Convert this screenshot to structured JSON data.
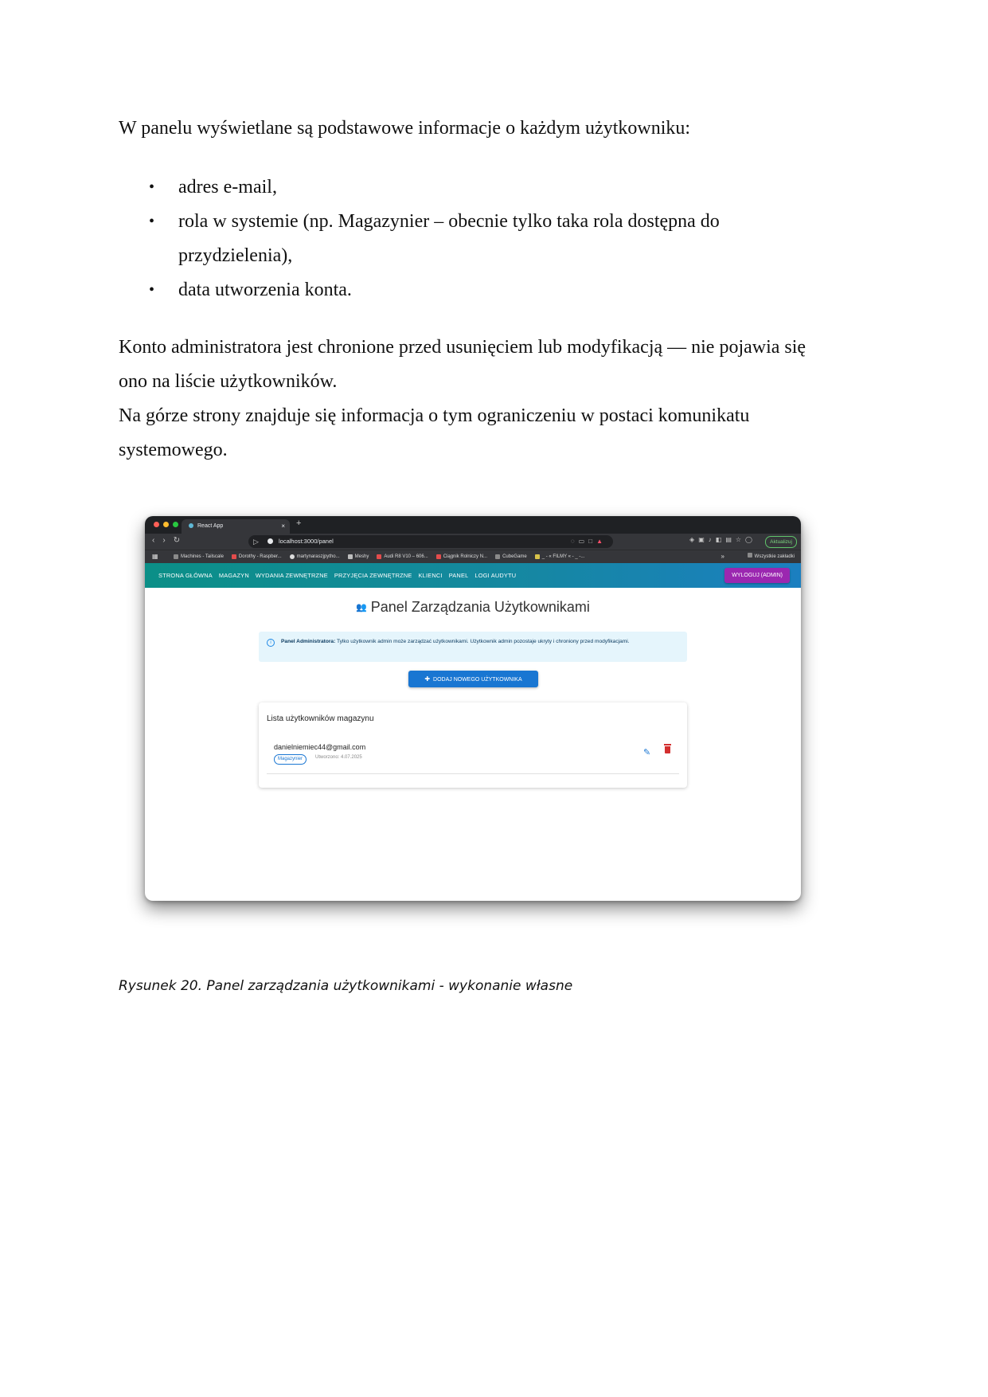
{
  "document": {
    "intro": "W panelu wyświetlane są podstawowe informacje o każdym użytkowniku:",
    "bullets": [
      "adres e-mail,",
      "rola w systemie (np. Magazynier – obecnie tylko taka rola dostępna do przydzielenia),",
      "data utworzenia konta."
    ],
    "paragraph_1": "Konto administratora jest chronione przed usunięciem lub modyfikacją — nie pojawia się ono na liście użytkowników.",
    "paragraph_2": "Na górze strony znajduje się informacja o tym ograniczeniu w postaci komunikatu systemowego.",
    "caption": "Rysunek 20. Panel zarządzania użytkownikami - wykonanie własne"
  },
  "browser": {
    "tab_title": "React App",
    "tab_close": "×",
    "new_tab": "+",
    "url": "localhost:3000/panel",
    "update_button": "Aktualizuj",
    "bookmarks": [
      {
        "label": "Machines - Tailscale",
        "color": "#8a8a8a"
      },
      {
        "label": "Dorothy - Raspber...",
        "color": "#e34c4c"
      },
      {
        "label": "martynaraszjpytho...",
        "color": "#dcdcdc"
      },
      {
        "label": "Meshy",
        "color": "#bdbdbd"
      },
      {
        "label": "Audi R8 V10 – 606...",
        "color": "#e34c4c"
      },
      {
        "label": "Ciągnik Rolniczy N...",
        "color": "#e34c4c"
      },
      {
        "label": "CubeGame",
        "color": "#8a8a8a"
      },
      {
        "label": "_ - « FILMY « - _ -...",
        "color": "#d8c34a"
      }
    ],
    "bookmarks_more": "»",
    "all_bookmarks": "Wszystkie zakładki"
  },
  "app": {
    "nav": [
      "STRONA GŁÓWNA",
      "MAGAZYN",
      "WYDANIA ZEWNĘTRZNE",
      "PRZYJĘCIA ZEWNĘTRZNE",
      "KLIENCI",
      "PANEL",
      "LOGI AUDYTU"
    ],
    "logout": "WYLOGUJ (ADMIN)",
    "page_title": "Panel Zarządzania Użytkownikami",
    "alert_bold": "Panel Administratora:",
    "alert_text": " Tylko użytkownik admin może zarządzać użytkownikami. Użytkownik admin pozostaje ukryty i chroniony przed modyfikacjami.",
    "add_user_button": "DODAJ NOWEGO UŻYTKOWNIKA",
    "list_title": "Lista użytkowników magazynu",
    "users": [
      {
        "email": "danielniemiec44@gmail.com",
        "role": "Magazynier",
        "created": "Utworzono: 4.07.2025"
      }
    ]
  },
  "colors": {
    "appbar_start": "#0b8f87",
    "appbar_end": "#1b7fc0",
    "logout": "#9b27b0",
    "primary": "#1976d2",
    "delete": "#d32f2f",
    "alert_bg": "#e5f5fc"
  },
  "icons": [
    "people-icon",
    "info-icon",
    "person-add-icon",
    "edit-icon",
    "delete-icon",
    "bookmark-icon",
    "reload-icon"
  ]
}
